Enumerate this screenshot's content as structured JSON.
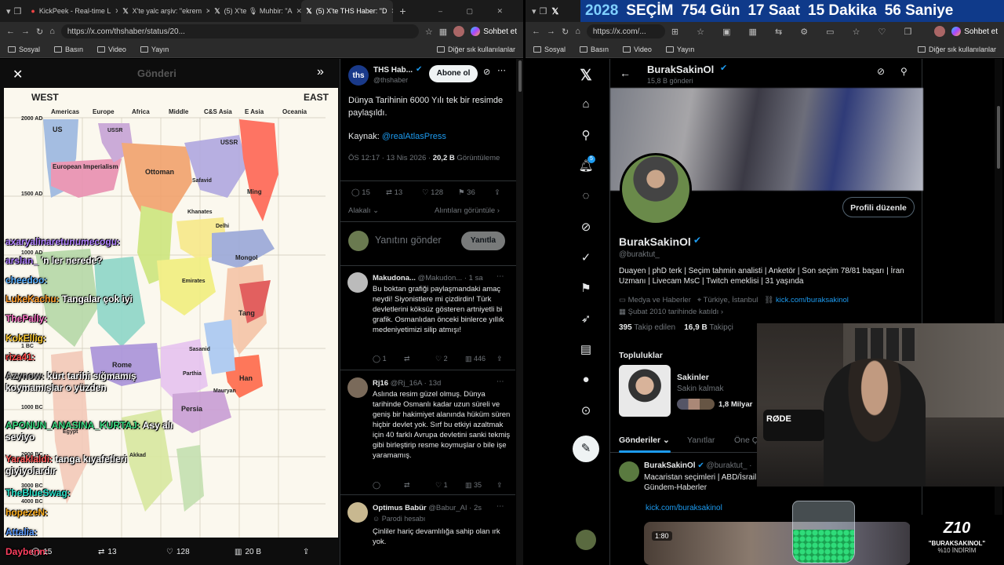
{
  "left_window": {
    "tabs": [
      {
        "label": "KickPeek - Real-time L"
      },
      {
        "label": "X'te yalc arşiv: \"ekrem"
      },
      {
        "label": "(5) X'te 🎙 Muhbir: \"A"
      },
      {
        "label": "(5) X'te THS Haber: \"D"
      }
    ],
    "url": "https://x.com/thshaber/status/20...",
    "profile_button": "Sohbet et",
    "bookmarks": [
      "Sosyal",
      "Basın",
      "Video",
      "Yayın"
    ],
    "other_bookmarks": "Diğer sık kullanılanlar"
  },
  "image_overlay": {
    "header_title": "Gönderi",
    "map": {
      "west": "WEST",
      "east": "EAST",
      "regions": [
        "Americas",
        "Europe",
        "Africa",
        "Middle",
        "C&S Asia",
        "E Asia",
        "Oceania"
      ],
      "years": [
        "2000 AD",
        "1500 AD",
        "1000 AD",
        "1 BC",
        "1000 BC",
        "2000 BC",
        "3000 BC",
        "4000 BC"
      ],
      "labels": [
        "US",
        "USSR",
        "European Imperialism",
        "Ottoman",
        "USSR",
        "Ming",
        "Safavid",
        "Delhi",
        "Khanates",
        "Mongol",
        "Emirates",
        "Tang",
        "Rome",
        "Han",
        "Persia",
        "Sasanid",
        "Parthia",
        "Mauryan",
        "Egypt",
        "Akkad"
      ]
    },
    "chat": [
      {
        "user": "axaryalinaretunumecogu:",
        "msg": ""
      },
      {
        "user": "arslan_",
        "msg": "'n ler nerede?"
      },
      {
        "user": "cheedoo:",
        "msg": ""
      },
      {
        "user": "LukeKachu:",
        "msg": "Tangalar çok iyi"
      },
      {
        "user": "ThePally:",
        "msg": ""
      },
      {
        "user": "KokEllig:",
        "msg": ""
      },
      {
        "user": "riza41:",
        "msg": ""
      },
      {
        "user": "Azynow:",
        "msg": "kürt tarihi sığmamış koymamışlar o yüzden"
      },
      {
        "user": "APONUN_ANASINA_KURTAJ:",
        "msg": "Asy alı seviyo"
      },
      {
        "user": "Yaraklaldi:",
        "msg": "tanga kıyafetleri giyiyolardır"
      },
      {
        "user": "TheBlueSwag:",
        "msg": ""
      },
      {
        "user": "hopezeN:",
        "msg": ""
      },
      {
        "user": "Attalia:",
        "msg": ""
      },
      {
        "user": "Daybenn:",
        "msg": ""
      }
    ],
    "bottom_stats": {
      "retweets": "13",
      "likes": "128",
      "views": "20 B",
      "replies": "15"
    }
  },
  "post": {
    "author": "THS Hab...",
    "handle": "@thshaber",
    "avatar_text": "ths",
    "follow": "Abone ol",
    "text": "Dünya Tarihinin 6000 Yılı tek bir resimde paylaşıldı.",
    "source_label": "Kaynak:",
    "source_link": "@realAtlasPress",
    "timestamp": "ÖS 12:17 · 13 Nis 2026 ·",
    "views_count": "20,2 B",
    "views_label": "Görüntüleme",
    "replies": "15",
    "retweets": "13",
    "likes": "128",
    "bookmarks": "36",
    "relevant": "Alakalı",
    "quotes_link": "Alıntıları görüntüle",
    "reply_placeholder": "Yanıtını gönder",
    "reply_button": "Yanıtla"
  },
  "replies": [
    {
      "name": "Makudona...",
      "handle": "@Makudon...",
      "time": "· 1 sa",
      "text": "Bu boktan grafiği paylaşmandaki amaç neydi! Siyonistlere mi çizdirdin! Türk devletlerini köksüz gösteren artniyetli bi grafik. Osmanlıdan önceki binlerce yıllık medeniyetimizi silip atmışı!",
      "replies": "1",
      "likes": "2",
      "views": "446"
    },
    {
      "name": "Rj16",
      "handle": "@Rj_16A",
      "time": "· 13d",
      "text": "Aslında resim güzel olmuş. Dünya tarihinde Osmanlı kadar uzun süreli ve geniş bir hakimiyet alanında hüküm süren hiçbir devlet yok. Sırf bu etkiyi azaltmak için 40 farklı Avrupa devletini sanki tekmiş gibi birleştirip resme koymuşlar o bile işe yaramamış.",
      "replies": "",
      "likes": "1",
      "views": "35"
    },
    {
      "name": "Optimus Babür",
      "handle": "@Babur_AI",
      "time": "· 2s",
      "badge": "Parodi hesabı",
      "text": "Çinliler hariç devamlılığa sahip olan ırk yok."
    }
  ],
  "right_window": {
    "countdown": {
      "year": "2028",
      "word": "SEÇİM",
      "days": "754 Gün",
      "hours": "17 Saat",
      "minutes": "15 Dakika",
      "seconds": "56 Saniye"
    },
    "url": "https://x.com/...",
    "profile_button": "Sohbet et",
    "bookmarks": [
      "Sosyal",
      "Basın",
      "Video",
      "Yayın"
    ],
    "other_bookmarks": "Diğer sık kullanılanlar",
    "notif_badge": "5"
  },
  "profile": {
    "name": "BurakSakinOl",
    "posts": "15,8 B gönderi",
    "handle": "@buraktut_",
    "edit_button": "Profili düzenle",
    "bio": "Duayen | phD terk | Seçim tahmin analisti | Anketör | Son seçim 78/81 başarı | İran Uzmanı | Livecam MsC | Twitch emeklisi | 31 yaşında",
    "category": "Medya ve Haberler",
    "location": "Türkiye, İstanbul",
    "link": "kick.com/buraksakinol",
    "joined": "Şubat 2010 tarihinde katıldı",
    "following_count": "395",
    "following_label": "Takip edilen",
    "followers_count": "16,9 B",
    "followers_label": "Takipçi",
    "communities_title": "Topluluklar",
    "community_name": "Sakinler",
    "community_sub": "Sakin kalmak",
    "community_members": "1,8 Milyar",
    "tabs": [
      "Gönderiler",
      "Yanıtlar",
      "Öne Ç"
    ],
    "pinned_name": "BurakSakinOl",
    "pinned_handle": "@buraktut_ ·",
    "pinned_text": "Macaristan seçimleri | ABD/İsrail Gündem-Haberler",
    "pinned_link": "kick.com/buraksakinol",
    "video_time": "1:80"
  },
  "overlay": {
    "mic": "RØDE",
    "promo_logo": "Z10",
    "promo_code": "\"BURAKSAKINOL\"",
    "promo_discount": "%10 İNDİRİM"
  }
}
